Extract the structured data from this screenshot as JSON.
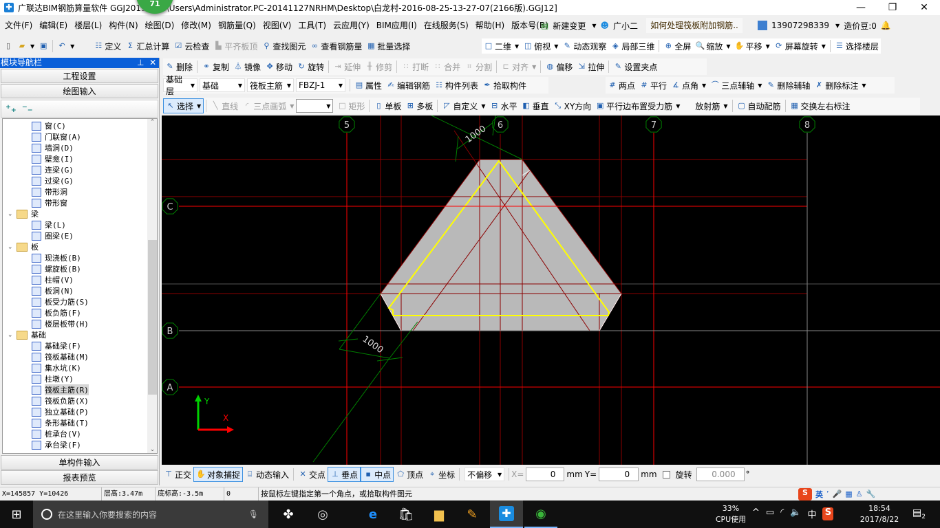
{
  "title": {
    "text": "广联达BIM钢筋算量软件 GGJ2013 - [C:\\Users\\Administrator.PC-20141127NRHM\\Desktop\\白龙村-2016-08-25-13-27-07(2166版).GGJ12]",
    "badge": "71"
  },
  "menu": [
    "文件(F)",
    "编辑(E)",
    "楼层(L)",
    "构件(N)",
    "绘图(D)",
    "修改(M)",
    "钢筋量(Q)",
    "视图(V)",
    "工具(T)",
    "云应用(Y)",
    "BIM应用(I)",
    "在线服务(S)",
    "帮助(H)",
    "版本号(B)"
  ],
  "menu_right": {
    "new_change": "新建变更",
    "assistant": "广小二",
    "question": "如何处理筏板附加钢筋..",
    "phone": "13907298339",
    "beans": "造价豆:0"
  },
  "toolbar1": [
    {
      "label": "定义",
      "icon": "define-icon"
    },
    {
      "label": "汇总计算",
      "icon": "sigma-icon"
    },
    {
      "label": "云检查",
      "icon": "cloud-check-icon"
    },
    {
      "label": "平齐板顶",
      "icon": "align-top-icon",
      "disabled": true
    },
    {
      "label": "查找图元",
      "icon": "binoculars-icon"
    },
    {
      "label": "查看钢筋量",
      "icon": "glasses-icon"
    },
    {
      "label": "批量选择",
      "icon": "batch-select-icon"
    }
  ],
  "toolbar1_view": [
    {
      "label": "二维",
      "icon": "2d-icon",
      "dd": true
    },
    {
      "label": "俯视",
      "icon": "top-view-icon",
      "dd": true
    },
    {
      "label": "动态观察",
      "icon": "orbit-icon"
    },
    {
      "label": "局部三维",
      "icon": "local-3d-icon"
    },
    {
      "label": "全屏",
      "icon": "fullscreen-icon"
    },
    {
      "label": "缩放",
      "icon": "zoom-icon",
      "dd": true
    },
    {
      "label": "平移",
      "icon": "pan-icon",
      "dd": true
    },
    {
      "label": "屏幕旋转",
      "icon": "rotate-screen-icon",
      "dd": true
    },
    {
      "label": "选择楼层",
      "icon": "select-floor-icon"
    }
  ],
  "edit_toolbar": [
    {
      "label": "删除",
      "icon": "delete-icon"
    },
    {
      "label": "复制",
      "icon": "copy-icon"
    },
    {
      "label": "镜像",
      "icon": "mirror-icon"
    },
    {
      "label": "移动",
      "icon": "move-icon"
    },
    {
      "label": "旋转",
      "icon": "rotate-icon"
    },
    {
      "label": "延伸",
      "icon": "extend-icon",
      "disabled": true
    },
    {
      "label": "修剪",
      "icon": "trim-icon",
      "disabled": true
    },
    {
      "label": "打断",
      "icon": "break-icon",
      "disabled": true
    },
    {
      "label": "合并",
      "icon": "merge-icon",
      "disabled": true
    },
    {
      "label": "分割",
      "icon": "split-icon",
      "disabled": true
    },
    {
      "label": "对齐",
      "icon": "align-icon",
      "disabled": true,
      "dd": true
    },
    {
      "label": "偏移",
      "icon": "offset-icon"
    },
    {
      "label": "拉伸",
      "icon": "stretch-icon"
    },
    {
      "label": "设置夹点",
      "icon": "grip-icon"
    }
  ],
  "selectors": [
    "基础层",
    "基础",
    "筏板主筋",
    "FBZJ-1"
  ],
  "component_toolbar": [
    {
      "label": "属性",
      "icon": "properties-icon"
    },
    {
      "label": "编辑钢筋",
      "icon": "edit-rebar-icon"
    },
    {
      "label": "构件列表",
      "icon": "component-list-icon"
    },
    {
      "label": "拾取构件",
      "icon": "pick-icon"
    }
  ],
  "aux_toolbar": [
    {
      "label": "两点",
      "icon": "two-point-icon"
    },
    {
      "label": "平行",
      "icon": "parallel-icon"
    },
    {
      "label": "点角",
      "icon": "point-angle-icon",
      "dd": true
    },
    {
      "label": "三点辅轴",
      "icon": "three-point-axis-icon",
      "dd": true
    },
    {
      "label": "删除辅轴",
      "icon": "delete-axis-icon"
    },
    {
      "label": "删除标注",
      "icon": "delete-dim-icon",
      "dd": true
    }
  ],
  "draw_toolbar": [
    {
      "label": "选择",
      "icon": "cursor-icon",
      "dd": true,
      "active": true
    },
    {
      "label": "直线",
      "icon": "line-icon",
      "disabled": true
    },
    {
      "label": "三点画弧",
      "icon": "arc-icon",
      "disabled": true,
      "dd": true
    },
    {
      "label": "",
      "icon": "",
      "combo": true
    },
    {
      "label": "矩形",
      "icon": "rect-icon",
      "disabled": true
    },
    {
      "label": "单板",
      "icon": "single-slab-icon"
    },
    {
      "label": "多板",
      "icon": "multi-slab-icon"
    },
    {
      "label": "自定义",
      "icon": "custom-icon",
      "dd": true
    },
    {
      "label": "水平",
      "icon": "horizontal-icon"
    },
    {
      "label": "垂直",
      "icon": "vertical-icon"
    },
    {
      "label": "XY方向",
      "icon": "xy-icon"
    },
    {
      "label": "平行边布置受力筋",
      "icon": "parallel-rebar-icon",
      "dd": true
    },
    {
      "label": "放射筋",
      "icon": "radial-icon",
      "dd": true
    },
    {
      "label": "自动配筋",
      "icon": "auto-rebar-icon"
    },
    {
      "label": "交换左右标注",
      "icon": "swap-icon"
    }
  ],
  "sidebar": {
    "title": "模块导航栏",
    "sections": [
      "工程设置",
      "绘图输入"
    ],
    "bottom": [
      "单构件输入",
      "报表预览"
    ],
    "tree": [
      {
        "label": "窗(C)",
        "d": 2
      },
      {
        "label": "门联窗(A)",
        "d": 2
      },
      {
        "label": "墙洞(D)",
        "d": 2
      },
      {
        "label": "壁龛(I)",
        "d": 2
      },
      {
        "label": "连梁(G)",
        "d": 2
      },
      {
        "label": "过梁(G)",
        "d": 2
      },
      {
        "label": "带形洞",
        "d": 2
      },
      {
        "label": "带形窗",
        "d": 2
      },
      {
        "label": "梁",
        "d": 1,
        "folder": true
      },
      {
        "label": "梁(L)",
        "d": 2
      },
      {
        "label": "圈梁(E)",
        "d": 2
      },
      {
        "label": "板",
        "d": 1,
        "folder": true
      },
      {
        "label": "现浇板(B)",
        "d": 2
      },
      {
        "label": "螺旋板(B)",
        "d": 2
      },
      {
        "label": "柱帽(V)",
        "d": 2
      },
      {
        "label": "板洞(N)",
        "d": 2
      },
      {
        "label": "板受力筋(S)",
        "d": 2
      },
      {
        "label": "板负筋(F)",
        "d": 2
      },
      {
        "label": "楼层板带(H)",
        "d": 2
      },
      {
        "label": "基础",
        "d": 1,
        "folder": true
      },
      {
        "label": "基础梁(F)",
        "d": 2
      },
      {
        "label": "筏板基础(M)",
        "d": 2
      },
      {
        "label": "集水坑(K)",
        "d": 2
      },
      {
        "label": "柱墩(Y)",
        "d": 2
      },
      {
        "label": "筏板主筋(R)",
        "d": 2,
        "selected": true
      },
      {
        "label": "筏板负筋(X)",
        "d": 2
      },
      {
        "label": "独立基础(P)",
        "d": 2
      },
      {
        "label": "条形基础(T)",
        "d": 2
      },
      {
        "label": "桩承台(V)",
        "d": 2
      },
      {
        "label": "承台梁(F)",
        "d": 2
      }
    ]
  },
  "canvas": {
    "axes_v": [
      "5",
      "6",
      "7",
      "8"
    ],
    "axes_h": [
      "C",
      "B",
      "A"
    ],
    "dims": [
      "1000",
      "1000"
    ],
    "ucs": {
      "x": "X",
      "y": "Y"
    },
    "colors": {
      "slab": "#b9b9b9",
      "rebar": "#ffff00",
      "axis": "#ff0000",
      "aux": "#8b0000",
      "dim": "#008000"
    }
  },
  "snapbar": {
    "items": [
      {
        "label": "正交",
        "icon": "ortho-icon"
      },
      {
        "label": "对象捕捉",
        "icon": "snap-icon",
        "active": true
      },
      {
        "label": "动态输入",
        "icon": "dynamic-input-icon"
      },
      {
        "label": "交点",
        "icon": "intersection-icon"
      },
      {
        "label": "垂点",
        "icon": "perpendicular-icon",
        "active": true
      },
      {
        "label": "中点",
        "icon": "midpoint-icon",
        "active": true
      },
      {
        "label": "顶点",
        "icon": "vertex-icon"
      },
      {
        "label": "坐标",
        "icon": "coordinate-icon"
      }
    ],
    "offset": "不偏移",
    "x_label": "X=",
    "x": "0",
    "y_label": "Y=",
    "y": "0",
    "unit": "mm",
    "rotate_label": "旋转",
    "rotate": "0.000",
    "deg": "°"
  },
  "status": {
    "coords": "X=145857 Y=10426",
    "floor_height": "层高:3.47m",
    "bottom_elev": "底标高:-3.5m",
    "value": "0",
    "hint": "按鼠标左键指定第一个角点，或拾取构件图元",
    "ime": "英"
  },
  "taskbar": {
    "search": "在这里输入你要搜索的内容",
    "cpu": "33%",
    "cpu_label": "CPU使用",
    "ime": "中",
    "time": "18:54",
    "date": "2017/8/22",
    "notifications": "2"
  }
}
